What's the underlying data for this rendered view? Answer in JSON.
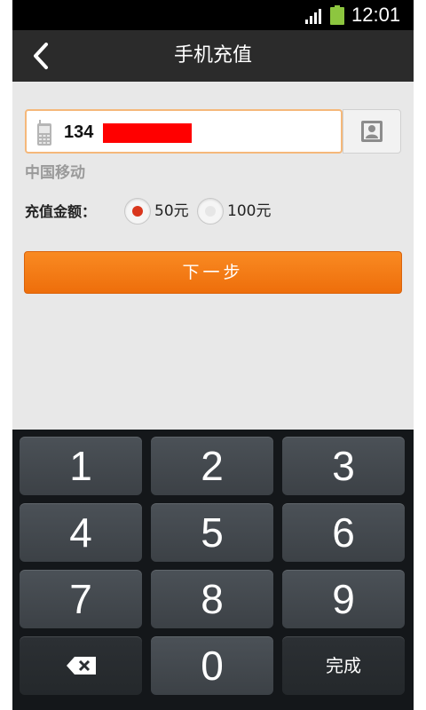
{
  "status_bar": {
    "time": "12:01",
    "signal_icon": "signal-bars-icon",
    "battery_icon": "battery-icon",
    "battery_color": "#8dc63f"
  },
  "header": {
    "title": "手机充值",
    "back_icon": "chevron-left-icon"
  },
  "form": {
    "phone_number_visible": "134",
    "phone_number_redacted": true,
    "carrier": "中国移动",
    "amount_label": "充值金额：",
    "amount_options": [
      {
        "label": "50元",
        "selected": true
      },
      {
        "label": "100元",
        "selected": false
      }
    ],
    "next_button_label": "下一步"
  },
  "colors": {
    "accent": "#f4791a",
    "selected_radio": "#d9361c",
    "input_border": "#f5b87a"
  },
  "keyboard": {
    "keys": [
      "1",
      "2",
      "3",
      "4",
      "5",
      "6",
      "7",
      "8",
      "9",
      "",
      "0",
      "完成"
    ],
    "backspace_icon": "backspace-icon",
    "done_label": "完成"
  }
}
